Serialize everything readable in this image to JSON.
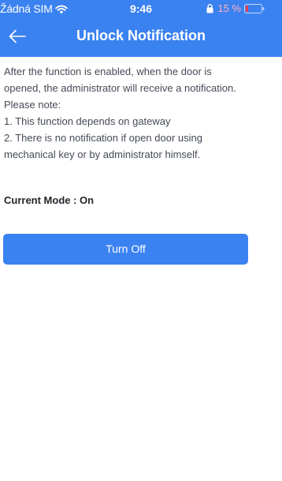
{
  "status_bar": {
    "carrier": "Žádná SIM",
    "time": "9:46",
    "battery": "15 %"
  },
  "nav": {
    "title": "Unlock Notification",
    "back_icon": "arrow-left-icon"
  },
  "content": {
    "lines": [
      "After the function is enabled, when the door is",
      "opened, the administrator will receive a notification.",
      "Please note:",
      "1. This function depends on gateway",
      "2. There is no notification if open door using",
      "mechanical key or by administrator himself."
    ],
    "current_mode": "Current Mode : On"
  },
  "action": {
    "button_label": "Turn Off"
  },
  "colors": {
    "accent": "#3b82f1",
    "battery_low": "#ff3b4d"
  }
}
